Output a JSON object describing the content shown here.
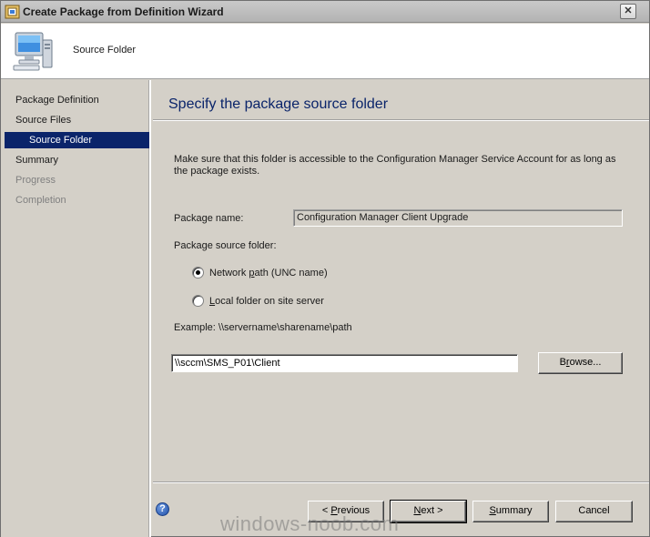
{
  "window": {
    "title": "Create Package from Definition Wizard"
  },
  "header": {
    "title": "Source Folder",
    "icon": "computer-wizard-icon"
  },
  "nav": {
    "items": [
      {
        "label": "Package Definition",
        "state": "normal"
      },
      {
        "label": "Source Files",
        "state": "normal"
      },
      {
        "label": "Source Folder",
        "state": "active"
      },
      {
        "label": "Summary",
        "state": "normal"
      },
      {
        "label": "Progress",
        "state": "disabled"
      },
      {
        "label": "Completion",
        "state": "disabled"
      }
    ]
  },
  "content": {
    "title": "Specify the package source folder",
    "description": "Make sure that this folder is accessible to the Configuration Manager Service Account for as long as the package exists.",
    "package_name_label": "Package name:",
    "package_name_value": "Configuration Manager Client Upgrade",
    "source_folder_label": "Package source folder:",
    "radio_network_label_pre": "Network ",
    "radio_network_label_u": "p",
    "radio_network_label_post": "ath (UNC name)",
    "radio_network_selected": true,
    "radio_local_label_pre": "",
    "radio_local_label_u": "L",
    "radio_local_label_post": "ocal folder on site server",
    "radio_local_selected": false,
    "example_label": "Example: \\\\servername\\sharename\\path",
    "path_value": "\\\\sccm\\SMS_P01\\Client",
    "browse_pre": "B",
    "browse_u": "r",
    "browse_post": "owse..."
  },
  "footer": {
    "previous_pre": "< ",
    "previous_u": "P",
    "previous_post": "revious",
    "next_pre": "",
    "next_u": "N",
    "next_post": "ext >",
    "summary_pre": "",
    "summary_u": "S",
    "summary_post": "ummary",
    "cancel_label": "Cancel",
    "help_glyph": "?"
  },
  "watermark": "windows-noob.com",
  "colors": {
    "accent": "#0a246a",
    "face": "#d4d0c8"
  }
}
